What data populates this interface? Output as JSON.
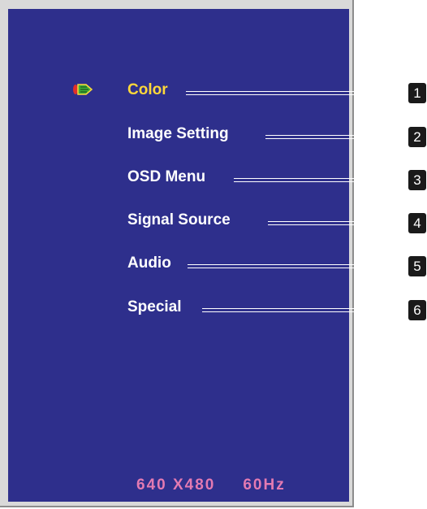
{
  "menu": {
    "items": [
      {
        "label": "Color",
        "number": "1",
        "selected": true
      },
      {
        "label": "Image Setting",
        "number": "2",
        "selected": false
      },
      {
        "label": "OSD Menu",
        "number": "3",
        "selected": false
      },
      {
        "label": "Signal Source",
        "number": "4",
        "selected": false
      },
      {
        "label": "Audio",
        "number": "5",
        "selected": false
      },
      {
        "label": "Special",
        "number": "6",
        "selected": false
      }
    ]
  },
  "status": {
    "resolution": "640 X480",
    "refresh": "60Hz"
  },
  "colors": {
    "panel_bg": "#2e2f8c",
    "selected_text": "#ffd83a",
    "status_text": "#e37ab2"
  },
  "icons": {
    "selector": "pointer-arrow-icon"
  }
}
